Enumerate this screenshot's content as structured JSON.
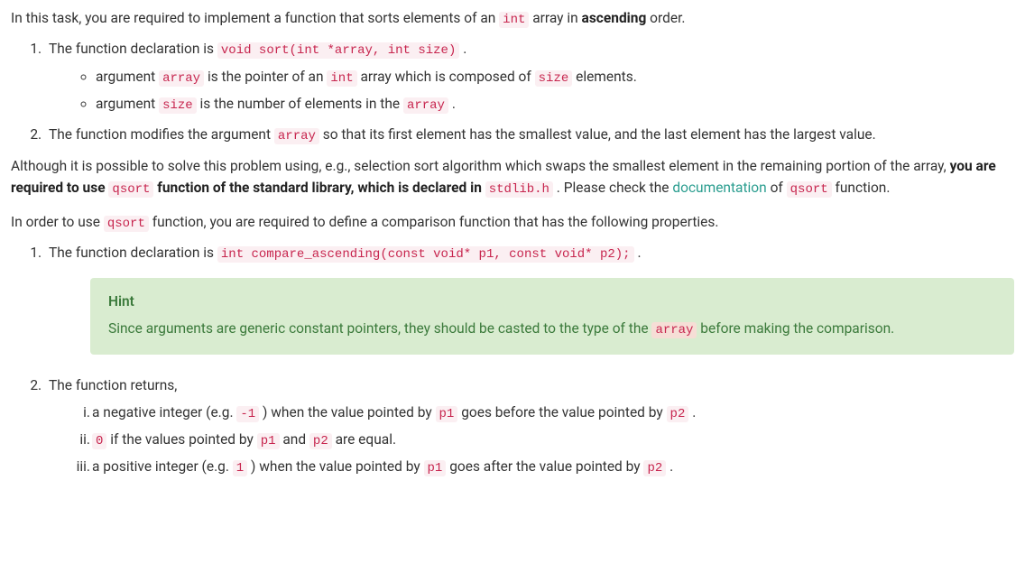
{
  "intro": {
    "p1_a": "In this task, you are required to implement a function that sorts elements of an ",
    "p1_code": "int",
    "p1_b": " array in ",
    "p1_bold": "ascending",
    "p1_c": " order."
  },
  "list1": {
    "item1_a": "The function declaration is ",
    "item1_code": "void sort(int *array, int size)",
    "item1_b": " .",
    "sub1_a": "argument ",
    "sub1_code1": "array",
    "sub1_b": " is the pointer of an ",
    "sub1_code2": "int",
    "sub1_c": " array which is composed of ",
    "sub1_code3": "size",
    "sub1_d": " elements.",
    "sub2_a": "argument ",
    "sub2_code1": "size",
    "sub2_b": " is the number of elements in the ",
    "sub2_code2": "array",
    "sub2_c": " .",
    "item2_a": "The function modifies the argument ",
    "item2_code": "array",
    "item2_b": " so that its first element has the smallest value, and the last element has the largest value."
  },
  "para2": {
    "a": "Although it is possible to solve this problem using, e.g., selection sort algorithm which swaps the smallest element in the remaining portion of the array, ",
    "bold1": "you are required to use ",
    "code1": "qsort",
    "bold2": " function of the standard library, which is declared in ",
    "code2": "stdlib.h",
    "b": " . Please check the ",
    "link": "documentation",
    "c": " of ",
    "code3": "qsort",
    "d": " function."
  },
  "para3": {
    "a": "In order to use ",
    "code1": "qsort",
    "b": " function, you are required to define a comparison function that has the following properties."
  },
  "list2": {
    "item1_a": "The function declaration is ",
    "item1_code": "int compare_ascending(const void* p1, const void* p2);",
    "item1_b": " .",
    "item2": "The function returns,"
  },
  "hint": {
    "title": "Hint",
    "body_a": "Since arguments are generic constant pointers, they should be casted to the type of the ",
    "body_code": "array",
    "body_b": " before making the comparison."
  },
  "roman": {
    "i_a": "a negative integer (e.g. ",
    "i_code1": "-1",
    "i_b": " ) when the value pointed by ",
    "i_code2": "p1",
    "i_c": " goes before the value pointed by ",
    "i_code3": "p2",
    "i_d": " .",
    "ii_code1": "0",
    "ii_a": " if the values pointed by ",
    "ii_code2": "p1",
    "ii_b": " and ",
    "ii_code3": "p2",
    "ii_c": " are equal.",
    "iii_a": "a positive integer (e.g. ",
    "iii_code1": "1",
    "iii_b": " ) when the value pointed by ",
    "iii_code2": "p1",
    "iii_c": " goes after the value pointed by ",
    "iii_code3": "p2",
    "iii_d": " ."
  }
}
